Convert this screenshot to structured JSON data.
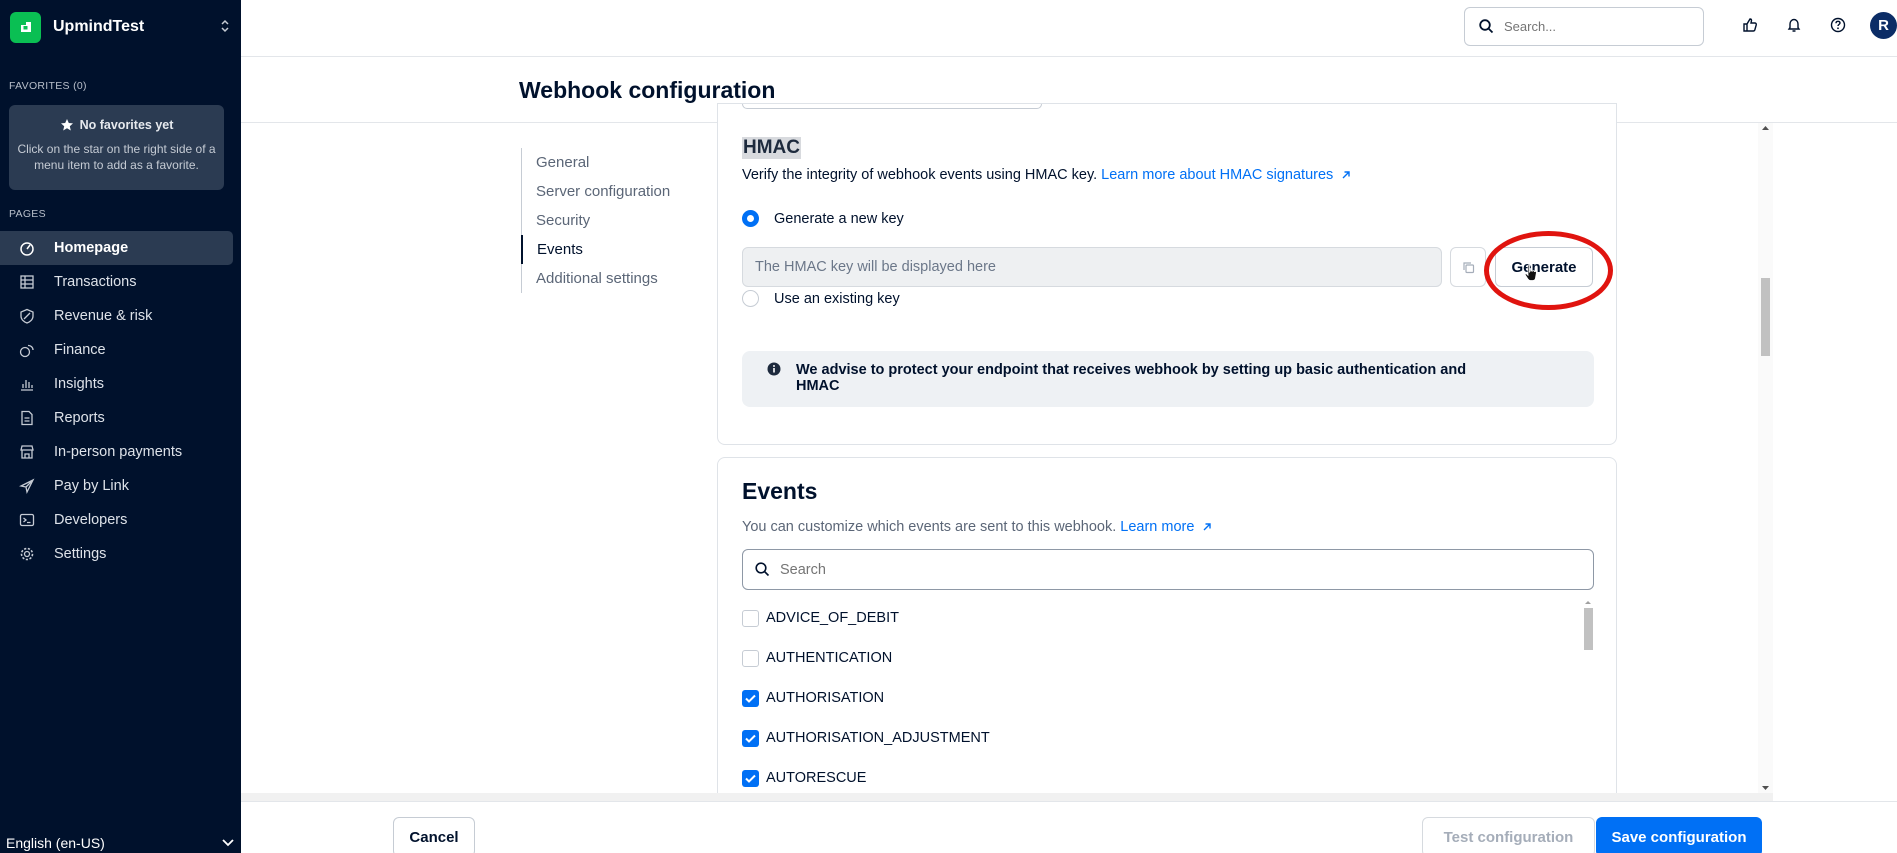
{
  "sidebar": {
    "brand": "UpmindTest",
    "favorites_label": "FAVORITES (0)",
    "favorites_empty_title": "No favorites yet",
    "favorites_empty_desc": "Click on the star on the right side of a menu item to add as a favorite.",
    "pages_label": "PAGES",
    "items": [
      {
        "label": "Homepage",
        "icon": "home-icon",
        "active": true
      },
      {
        "label": "Transactions",
        "icon": "table-icon"
      },
      {
        "label": "Revenue & risk",
        "icon": "shield-icon"
      },
      {
        "label": "Finance",
        "icon": "coins-icon"
      },
      {
        "label": "Insights",
        "icon": "bar-chart-icon"
      },
      {
        "label": "Reports",
        "icon": "document-icon"
      },
      {
        "label": "In-person payments",
        "icon": "store-icon"
      },
      {
        "label": "Pay by Link",
        "icon": "send-icon"
      },
      {
        "label": "Developers",
        "icon": "terminal-icon"
      },
      {
        "label": "Settings",
        "icon": "gear-icon"
      }
    ],
    "language": "English (en-US)"
  },
  "topbar": {
    "search_placeholder": "Search...",
    "avatar_initial": "R"
  },
  "page": {
    "title": "Webhook configuration"
  },
  "subnav": {
    "items": [
      "General",
      "Server configuration",
      "Security",
      "Events",
      "Additional settings"
    ],
    "active": "Events"
  },
  "hmac": {
    "title": "HMAC",
    "description": "Verify the integrity of webhook events using HMAC key.",
    "learn_more": "Learn more about HMAC signatures",
    "option_generate": "Generate a new key",
    "key_placeholder": "The HMAC key will be displayed here",
    "generate_button": "Generate",
    "option_existing": "Use an existing key",
    "advice": "We advise to protect your endpoint that receives webhook by setting up basic authentication and HMAC"
  },
  "events": {
    "title": "Events",
    "description": "You can customize which events are sent to this webhook.",
    "learn_more": "Learn more",
    "search_placeholder": "Search",
    "list": [
      {
        "label": "ADVICE_OF_DEBIT",
        "checked": false
      },
      {
        "label": "AUTHENTICATION",
        "checked": false
      },
      {
        "label": "AUTHORISATION",
        "checked": true
      },
      {
        "label": "AUTHORISATION_ADJUSTMENT",
        "checked": true
      },
      {
        "label": "AUTORESCUE",
        "checked": true
      }
    ]
  },
  "footer": {
    "cancel": "Cancel",
    "test": "Test configuration",
    "save": "Save configuration"
  },
  "colors": {
    "sidebar_bg": "#00112c",
    "accent": "#0070f5",
    "brand_green": "#0abf53",
    "highlight_ring": "#e0140f"
  }
}
